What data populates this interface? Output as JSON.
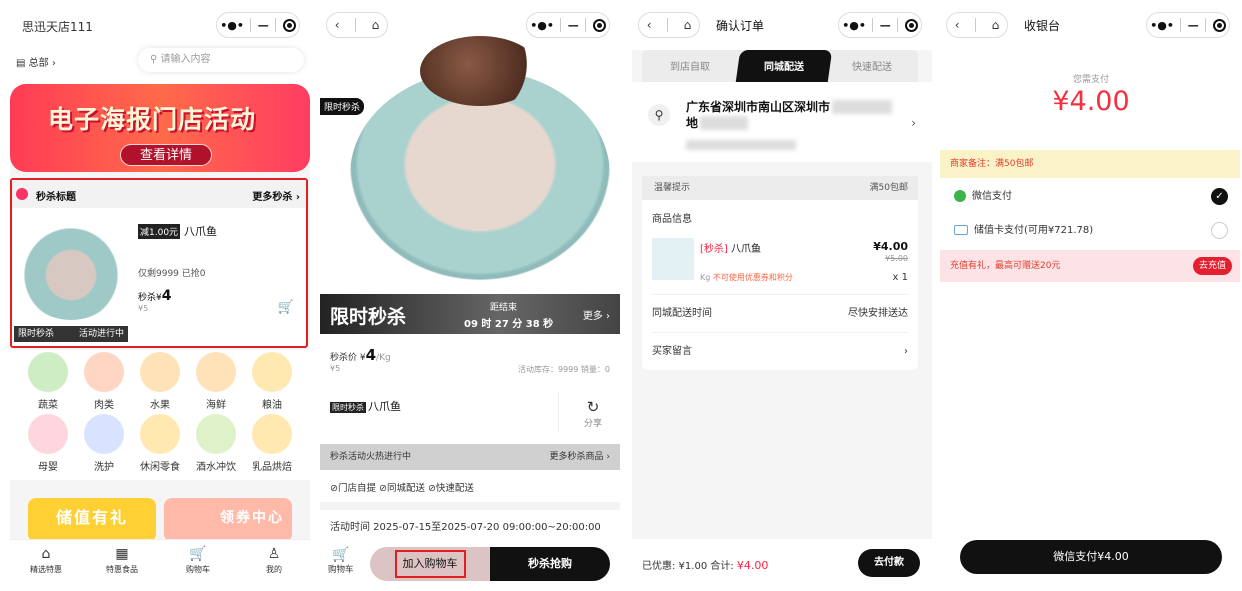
{
  "p1": {
    "store_name": "思迅天店111",
    "hq": "总部",
    "search_placeholder": "请输入内容",
    "banner_title": "电子海报门店活动",
    "banner_button": "查看详情",
    "seckill": {
      "title": "秒杀标题",
      "more": "更多秒杀",
      "discount_badge": "减1.00元",
      "product_name": "八爪鱼",
      "stock": "仅剩9999  已抢0",
      "price_label": "秒杀¥",
      "price": "4",
      "old_price": "¥5",
      "tag_left": "限时秒杀",
      "tag_right": "活动进行中"
    },
    "categories": [
      "蔬菜",
      "肉类",
      "水果",
      "海鲜",
      "粮油",
      "母婴",
      "洗护",
      "休闲零食",
      "酒水冲饮",
      "乳品烘焙"
    ],
    "category_colors": [
      "#cdeec4",
      "#ffe2b8",
      "#ffe2b8",
      "#ffe2b8",
      "#ffe2b8",
      "#ffd6de",
      "#d8e4ff",
      "#ffe9b0",
      "#dff1c8",
      "#ffe9b0"
    ],
    "promo_left": "储值有礼",
    "promo_right": "领券中心",
    "tabbar": [
      "精选特惠",
      "特惠食品",
      "购物车",
      "我的"
    ]
  },
  "p2": {
    "limited_tag": "限时秒杀",
    "flash_title": "限时秒杀",
    "countdown_label": "距结束",
    "countdown": "09 时 27 分 38 秒",
    "more": "更多",
    "price_label": "秒杀价 ¥",
    "price": "4",
    "unit": "/Kg",
    "old_price": "¥5",
    "stock": "活动库存：9999   销量：0",
    "name_badge": "限时秒杀",
    "product_name": "八爪鱼",
    "share": "分享",
    "hot_text": "秒杀活动火热进行中",
    "hot_more": "更多秒杀商品",
    "delivery": "⊘门店自提  ⊘同城配送  ⊘快速配送",
    "activity_time": "活动时间  2025-07-15至2025-07-20 09:00:00~20:00:00",
    "cart_label": "购物车",
    "add_cart": "加入购物车",
    "buy_now": "秒杀抢购"
  },
  "p3": {
    "title": "确认订单",
    "tabs": [
      "到店自取",
      "同城配送",
      "快速配送"
    ],
    "address": "广东省深圳市南山区深圳市",
    "address_line2": "地",
    "tip": "温馨提示",
    "tip_right": "满50包邮",
    "goods_header": "商品信息",
    "goods_tag": "[秒杀]",
    "goods_name": "八爪鱼",
    "goods_price": "¥4.00",
    "goods_old_price": "¥5.00",
    "goods_qty": "x 1",
    "goods_unit": "Kg",
    "goods_note": "不可使用优惠券和积分",
    "delivery_time_label": "同城配送时间",
    "delivery_time_value": "尽快安排送达",
    "message_label": "买家留言",
    "discount": "已优惠: ¥1.00   合计:",
    "total": "¥4.00",
    "pay_button": "去付款"
  },
  "p4": {
    "title": "收银台",
    "need_pay": "您需支付",
    "amount": "¥4.00",
    "note": "商家备注：满50包邮",
    "wechat_pay": "微信支付",
    "card_pay": "储值卡支付(可用¥721.78)",
    "recharge_text": "充值有礼，最高可赠送20元",
    "recharge_btn": "去充值",
    "wx_button": "微信支付¥4.00"
  }
}
